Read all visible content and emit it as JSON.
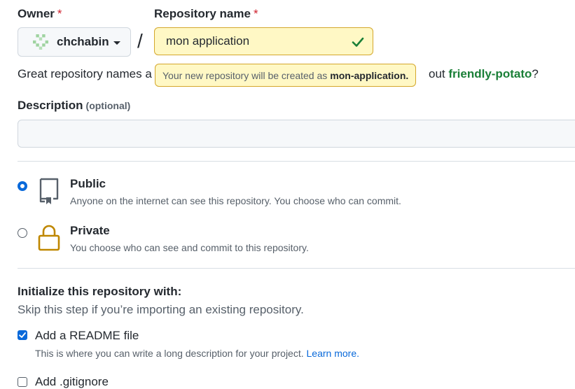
{
  "owner": {
    "label": "Owner",
    "required_mark": "*",
    "selected": "chchabin"
  },
  "repo_name": {
    "label": "Repository name",
    "required_mark": "*",
    "value": "mon application",
    "tooltip_prefix": "Your new repository will be created as",
    "tooltip_name": "mon-application."
  },
  "slash": "/",
  "hint": {
    "prefix": "Great repository names a",
    "suffix": "out",
    "suggestion": "friendly-potato",
    "end": "?"
  },
  "description": {
    "label": "Description",
    "optional": "(optional)",
    "value": ""
  },
  "visibility": {
    "public": {
      "title": "Public",
      "desc": "Anyone on the internet can see this repository. You choose who can commit."
    },
    "private": {
      "title": "Private",
      "desc": "You choose who can see and commit to this repository."
    }
  },
  "init": {
    "title": "Initialize this repository with:",
    "subtitle": "Skip this step if you’re importing an existing repository.",
    "readme": {
      "label": "Add a README file",
      "desc": "This is where you can write a long description for your project.",
      "link": "Learn more."
    },
    "partial_label": "Add .gitignore"
  },
  "colors": {
    "accent": "#0969da",
    "success": "#1a7f37",
    "danger": "#cf222e",
    "warning_bg": "#fff8c5",
    "private_icon": "#bf8700"
  }
}
